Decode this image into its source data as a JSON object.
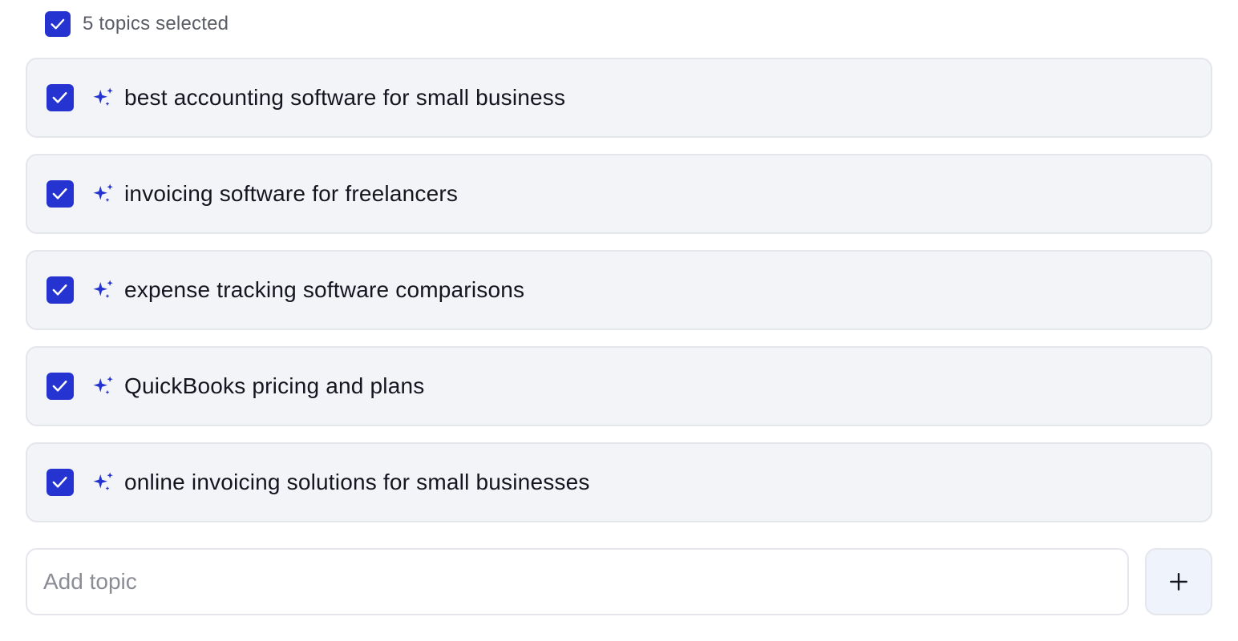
{
  "selection": {
    "count_label": "5 topics selected",
    "all_checked": true
  },
  "topics": [
    {
      "label": "best accounting software for small business",
      "checked": true,
      "icon": "sparkles-icon"
    },
    {
      "label": "invoicing software for freelancers",
      "checked": true,
      "icon": "sparkles-icon"
    },
    {
      "label": "expense tracking software comparisons",
      "checked": true,
      "icon": "sparkles-icon"
    },
    {
      "label": "QuickBooks pricing and plans",
      "checked": true,
      "icon": "sparkles-icon"
    },
    {
      "label": "online invoicing solutions for small businesses",
      "checked": true,
      "icon": "sparkles-icon"
    }
  ],
  "add_topic": {
    "value": "",
    "placeholder": "Add topic",
    "button_icon": "plus-icon"
  },
  "colors": {
    "accent": "#2533d1",
    "row_background": "#f3f4f8",
    "row_border": "#e4e6ec",
    "add_button_background": "#eef3fc"
  }
}
